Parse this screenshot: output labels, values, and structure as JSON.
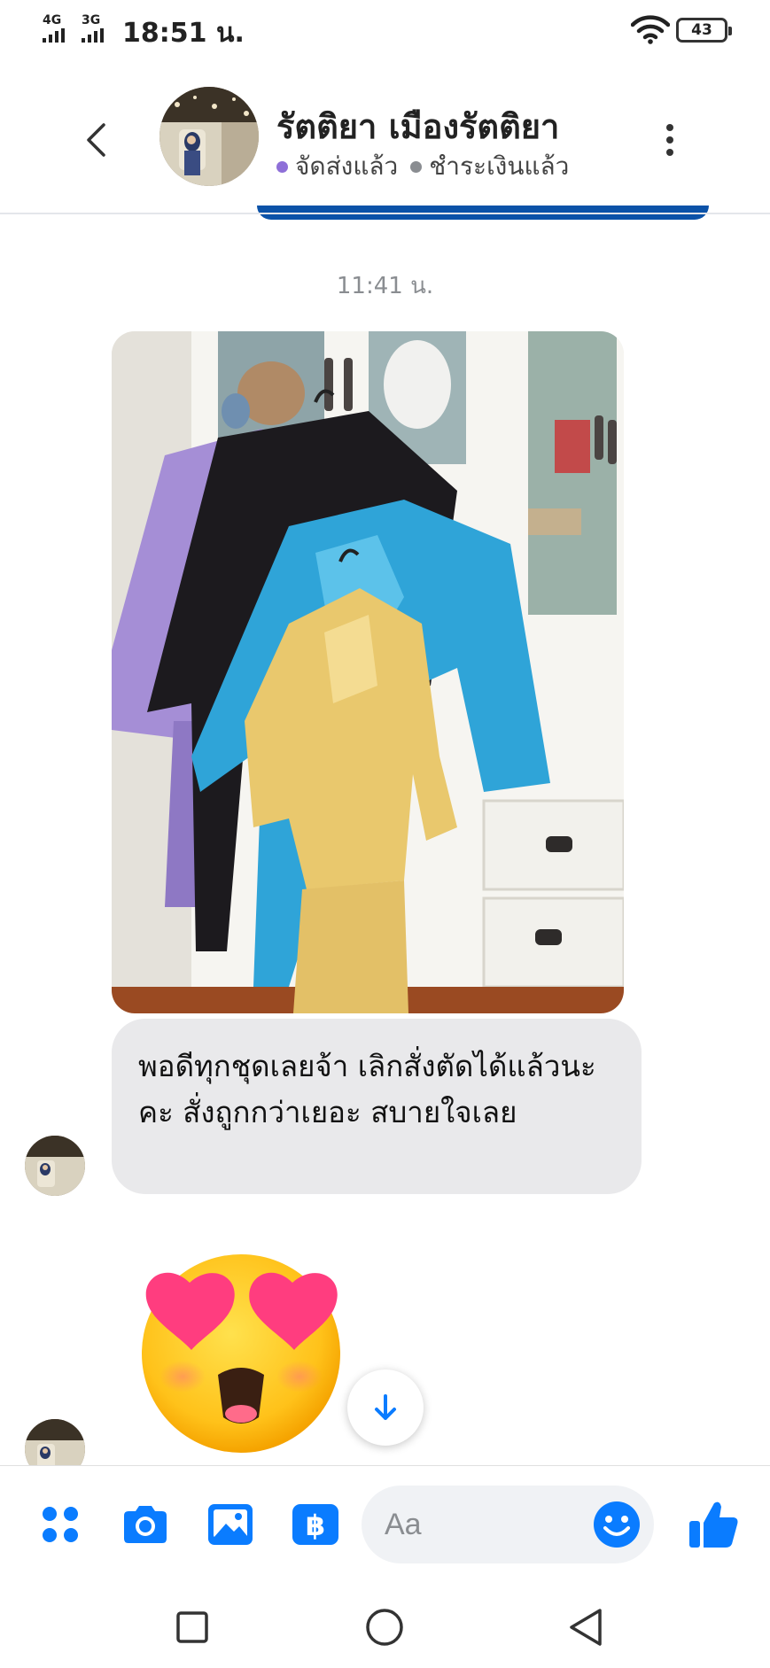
{
  "status_bar": {
    "network1": "4G",
    "network2": "3G",
    "time": "18:51 น.",
    "battery": "43"
  },
  "header": {
    "contact_name": "รัตติยา เมืองรัตติยา",
    "status1": "จัดส่งแล้ว",
    "status2": "ชำระเงินแล้ว",
    "icons": [
      "chevron-left-icon",
      "more-vertical-icon"
    ],
    "status1_dot_color": "#8e6fd8",
    "status2_dot_color": "#8a8d91"
  },
  "conversation": {
    "timestamp": "11:41 น.",
    "photo_description_icon": "photo-thai-outfits",
    "message_text": "พอดีทุกชุดเลยจ้า เลิกสั่งตัดได้แล้วนะคะ สั่งถูกกว่าเยอะ สบายใจเลย",
    "sticker": "heart-eyes-emoji"
  },
  "composer": {
    "placeholder": "Aa",
    "value": "",
    "icons": [
      "menu-dots-icon",
      "camera-icon",
      "image-icon",
      "baht-pay-icon",
      "emoji-icon",
      "thumbs-up-icon"
    ]
  },
  "nav_bar": {
    "icons": [
      "recents-square-icon",
      "home-circle-icon",
      "back-triangle-icon"
    ]
  },
  "colors": {
    "accent": "#0a7cff",
    "bubble": "#e9e9eb",
    "input_bg": "#f0f2f5"
  }
}
